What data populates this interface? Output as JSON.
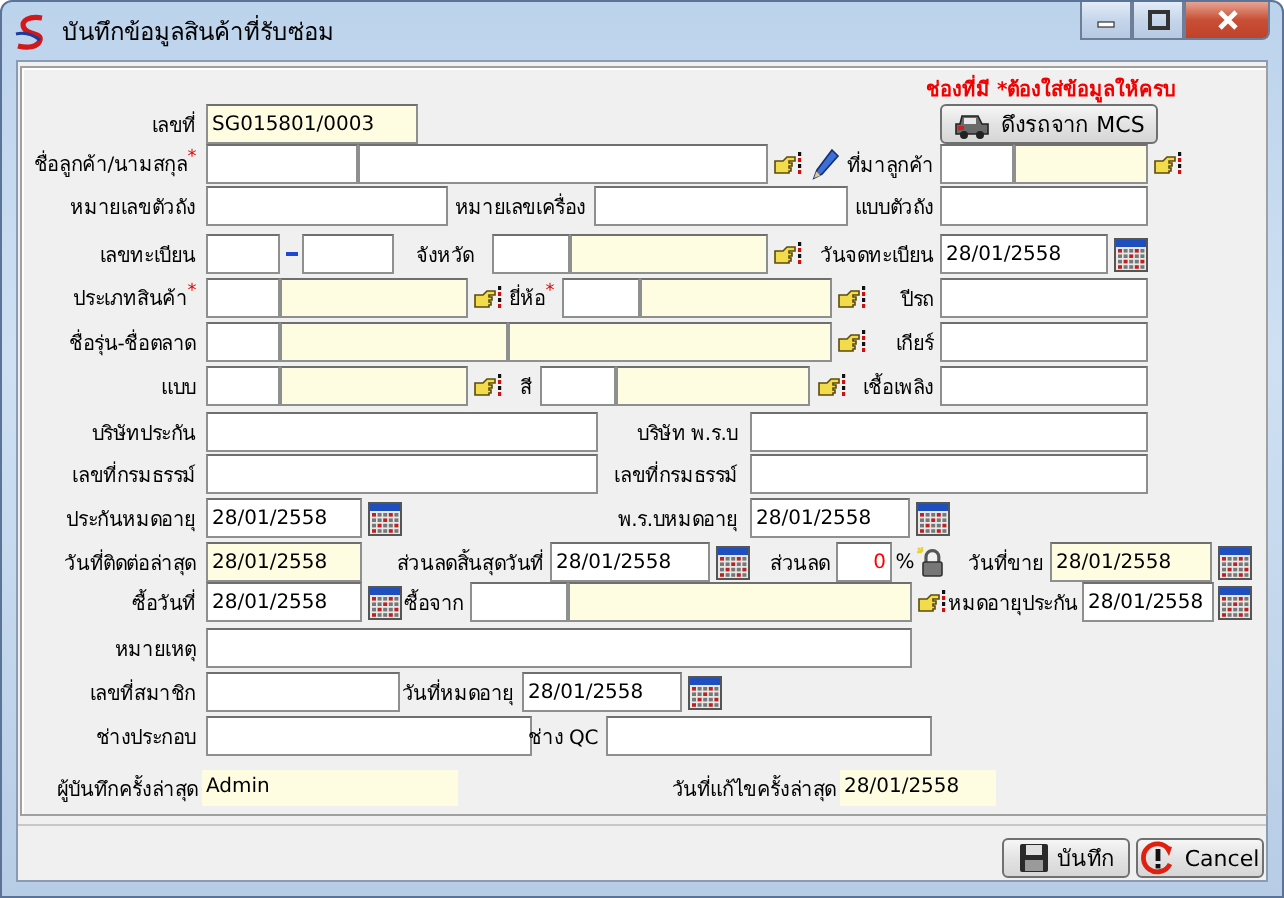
{
  "window": {
    "title": "บันทึกข้อมูลสินค้าที่รับซ่อม"
  },
  "rows": [
    {
      "items": [
        {
          "kind": "note",
          "text": "ช่องที่มี *ต้องใส่ข้อมูลให้ครบ"
        }
      ]
    },
    {
      "items": [
        {
          "kind": "label",
          "text": "เลขที่"
        },
        {
          "kind": "readonly",
          "value": "SG015801/0003"
        },
        {
          "kind": "action",
          "text": "ดึงรถจาก MCS"
        }
      ]
    },
    {
      "items": [
        {
          "kind": "label",
          "text": "ชื่อลูกค้า/นามสกุล",
          "mark": "*"
        },
        {
          "kind": "name"
        },
        {
          "kind": "lookup_button"
        },
        {
          "kind": "pencil_button"
        },
        {
          "kind": "label",
          "text": "ที่มาลูกค้า"
        },
        {
          "kind": "lookup"
        },
        {
          "kind": "lookup_button"
        }
      ]
    },
    {
      "items": [
        {
          "kind": "label",
          "text": "หมายเลขตัวถัง"
        },
        {
          "kind": "input"
        },
        {
          "kind": "label",
          "text": "หมายเลขเครื่อง"
        },
        {
          "kind": "input"
        },
        {
          "kind": "label",
          "text": "แบบตัวถัง"
        },
        {
          "kind": "input"
        }
      ]
    },
    {
      "items": [
        {
          "kind": "label",
          "text": "เลขทะเบียน"
        },
        {
          "kind": "input"
        },
        {
          "kind": "dash"
        },
        {
          "kind": "input"
        },
        {
          "kind": "label",
          "text": "จังหวัด"
        },
        {
          "kind": "lookup"
        },
        {
          "kind": "lookup_button"
        },
        {
          "kind": "label",
          "text": "วันจดทะเบียน"
        },
        {
          "kind": "date",
          "value": "28/01/2558"
        },
        {
          "kind": "calendar_button"
        }
      ]
    },
    {
      "items": [
        {
          "kind": "label",
          "text": "ประเภทสินค้า",
          "mark": "*"
        },
        {
          "kind": "lookup"
        },
        {
          "kind": "lookup_button"
        },
        {
          "kind": "label",
          "text": "ยี่ห้อ",
          "mark": "*"
        },
        {
          "kind": "lookup"
        },
        {
          "kind": "lookup_button"
        },
        {
          "kind": "label",
          "text": "ปีรถ"
        },
        {
          "kind": "input"
        }
      ]
    },
    {
      "items": [
        {
          "kind": "label",
          "text": "ชื่อรุ่น-ชื่อตลาด"
        },
        {
          "kind": "model"
        },
        {
          "kind": "lookup_button"
        },
        {
          "kind": "label",
          "text": "เกียร์"
        },
        {
          "kind": "input"
        }
      ]
    },
    {
      "items": [
        {
          "kind": "label",
          "text": "แบบ"
        },
        {
          "kind": "lookup"
        },
        {
          "kind": "lookup_button"
        },
        {
          "kind": "label",
          "text": "สี"
        },
        {
          "kind": "lookup"
        },
        {
          "kind": "lookup_button"
        },
        {
          "kind": "label",
          "text": "เชื้อเพลิง"
        },
        {
          "kind": "input"
        }
      ]
    },
    {
      "items": [
        {
          "kind": "label",
          "text": "บริษัทประกัน"
        },
        {
          "kind": "input"
        },
        {
          "kind": "label",
          "text": "บริษัท พ.ร.บ"
        },
        {
          "kind": "input"
        }
      ]
    },
    {
      "items": [
        {
          "kind": "label",
          "text": "เลขที่กรมธรรม์"
        },
        {
          "kind": "input"
        },
        {
          "kind": "label",
          "text": "เลขที่กรมธรรม์"
        },
        {
          "kind": "input"
        }
      ]
    },
    {
      "items": [
        {
          "kind": "label",
          "text": "ประกันหมดอายุ"
        },
        {
          "kind": "date",
          "value": "28/01/2558"
        },
        {
          "kind": "calendar_button"
        },
        {
          "kind": "label",
          "text": "พ.ร.บหมดอายุ"
        },
        {
          "kind": "date",
          "value": "28/01/2558"
        },
        {
          "kind": "calendar_button"
        }
      ]
    },
    {
      "items": [
        {
          "kind": "label",
          "text": "วันที่ติดต่อล่าสุด"
        },
        {
          "kind": "date_readonly",
          "value": "28/01/2558"
        },
        {
          "kind": "label",
          "text": "ส่วนลดสิ้นสุดวันที่"
        },
        {
          "kind": "date",
          "value": "28/01/2558"
        },
        {
          "kind": "calendar_button"
        },
        {
          "kind": "label",
          "text": "ส่วนลด"
        },
        {
          "kind": "number",
          "value": "0"
        },
        {
          "kind": "label",
          "text": "%"
        },
        {
          "kind": "lock_icon"
        },
        {
          "kind": "label",
          "text": "วันที่ขาย"
        },
        {
          "kind": "date_readonly",
          "value": "28/01/2558"
        },
        {
          "kind": "calendar_button"
        }
      ]
    },
    {
      "items": [
        {
          "kind": "label",
          "text": "ซื้อวันที่"
        },
        {
          "kind": "date",
          "value": "28/01/2558"
        },
        {
          "kind": "calendar_button"
        },
        {
          "kind": "label",
          "text": "ซื้อจาก"
        },
        {
          "kind": "lookup"
        },
        {
          "kind": "lookup_button"
        },
        {
          "kind": "label",
          "text": "หมดอายุประกัน"
        },
        {
          "kind": "date",
          "value": "28/01/2558"
        },
        {
          "kind": "calendar_button"
        }
      ]
    },
    {
      "items": [
        {
          "kind": "label",
          "text": "หมายเหตุ"
        },
        {
          "kind": "input"
        }
      ]
    },
    {
      "items": [
        {
          "kind": "label",
          "text": "เลขที่สมาชิก"
        },
        {
          "kind": "input"
        },
        {
          "kind": "label",
          "text": "วันที่หมดอายุ"
        },
        {
          "kind": "date",
          "value": "28/01/2558"
        },
        {
          "kind": "calendar_button"
        }
      ]
    },
    {
      "items": [
        {
          "kind": "label",
          "text": "ช่างประกอบ"
        },
        {
          "kind": "input"
        },
        {
          "kind": "label",
          "text": "ช่าง QC"
        },
        {
          "kind": "input"
        }
      ]
    },
    {
      "items": [
        {
          "kind": "label",
          "text": "ผู้บันทึกครั้งล่าสุด"
        },
        {
          "kind": "display",
          "value": "Admin"
        },
        {
          "kind": "label",
          "text": "วันที่แก้ไขครั้งล่าสุด"
        },
        {
          "kind": "display",
          "value": "28/01/2558"
        }
      ]
    }
  ],
  "buttons": [
    {
      "kind": "save",
      "label": "บันทึก"
    },
    {
      "kind": "cancel",
      "label": "Cancel"
    }
  ]
}
